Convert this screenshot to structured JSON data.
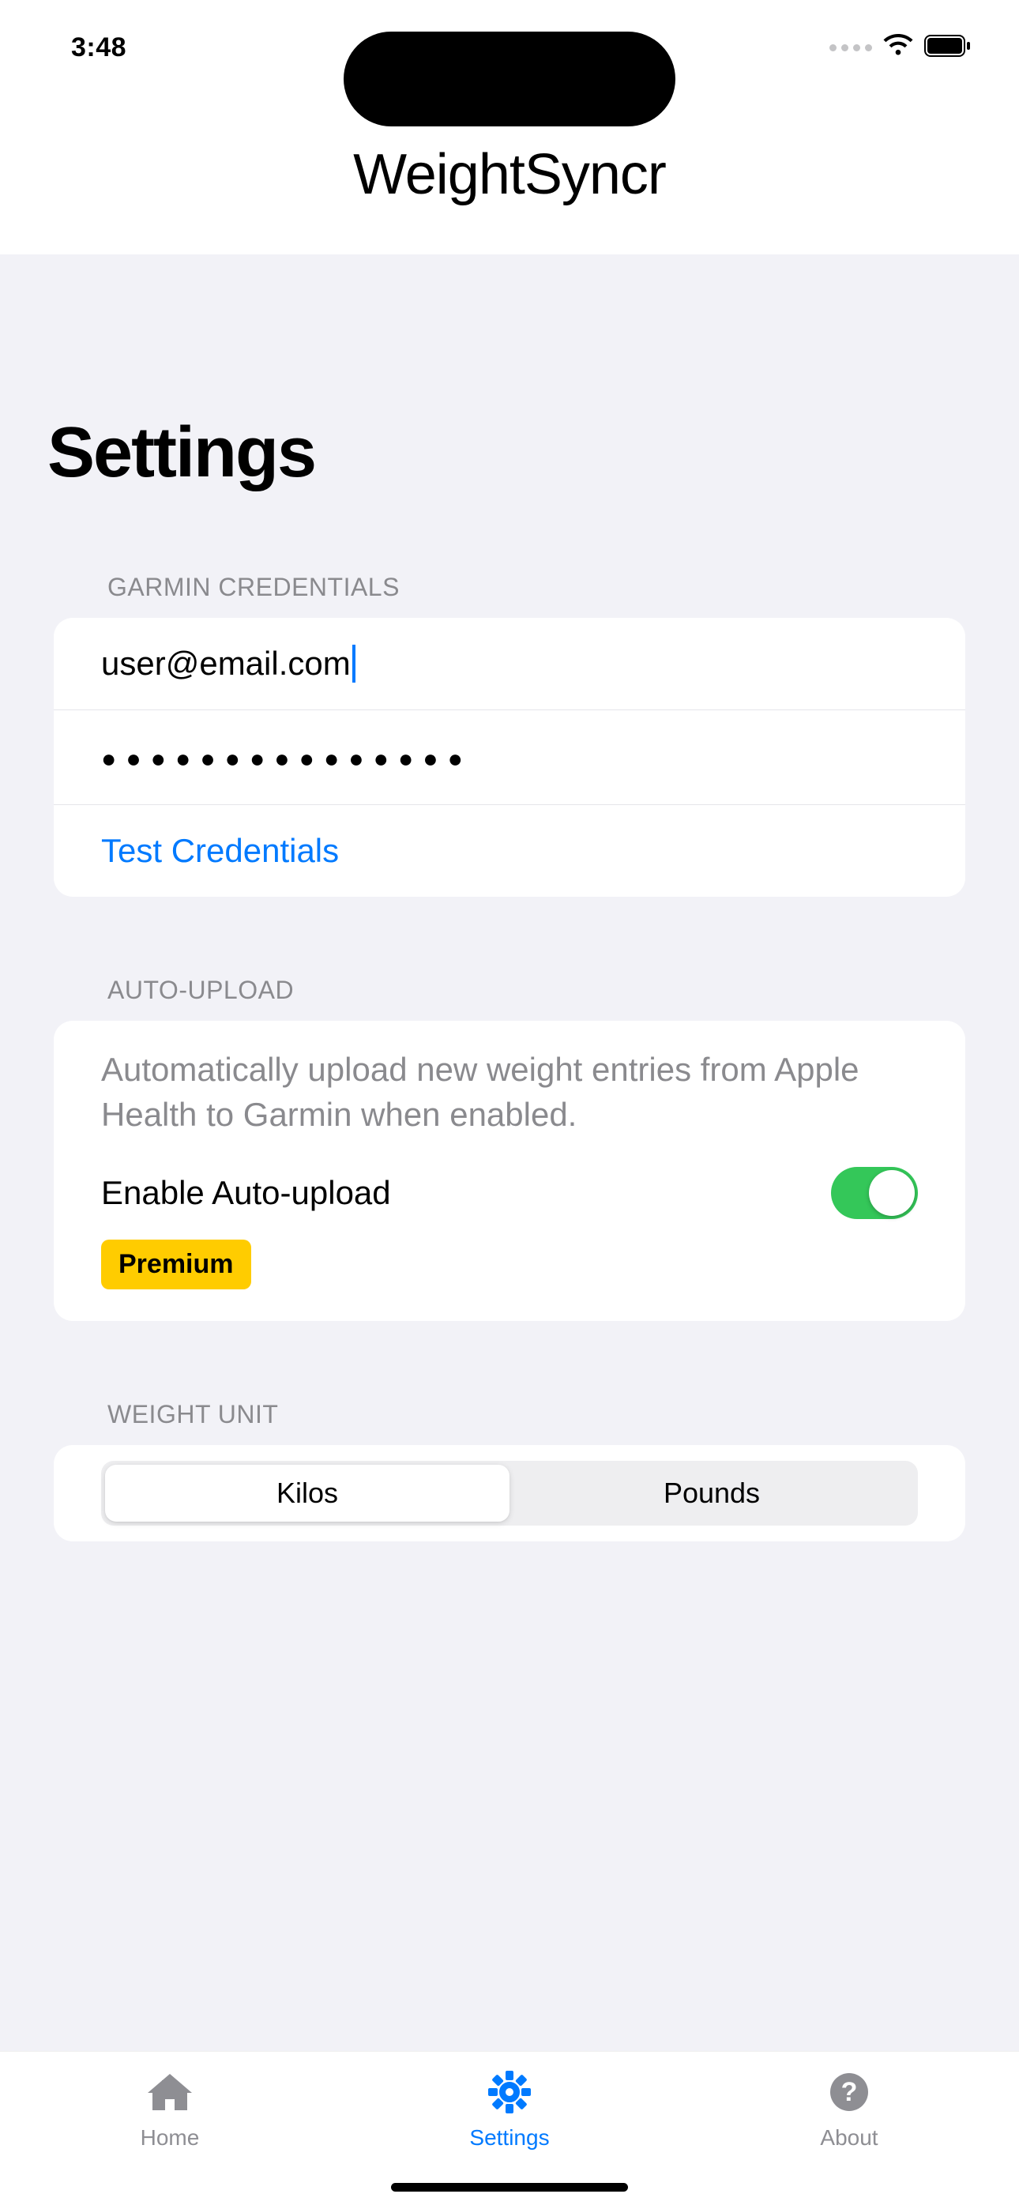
{
  "status": {
    "time": "3:48"
  },
  "header": {
    "app_title": "WeightSyncr"
  },
  "page": {
    "title": "Settings"
  },
  "sections": {
    "garmin": {
      "header": "GARMIN CREDENTIALS",
      "email_value": "user@email.com",
      "password_dots": "●●●●●●●●●●●●●●●",
      "test_label": "Test Credentials"
    },
    "auto_upload": {
      "header": "AUTO-UPLOAD",
      "description": "Automatically upload new weight entries from Apple Health to Garmin when enabled.",
      "toggle_label": "Enable Auto-upload",
      "badge": "Premium"
    },
    "weight_unit": {
      "header": "WEIGHT UNIT",
      "options": {
        "kilos": "Kilos",
        "pounds": "Pounds"
      }
    }
  },
  "tabs": {
    "home": "Home",
    "settings": "Settings",
    "about": "About"
  }
}
